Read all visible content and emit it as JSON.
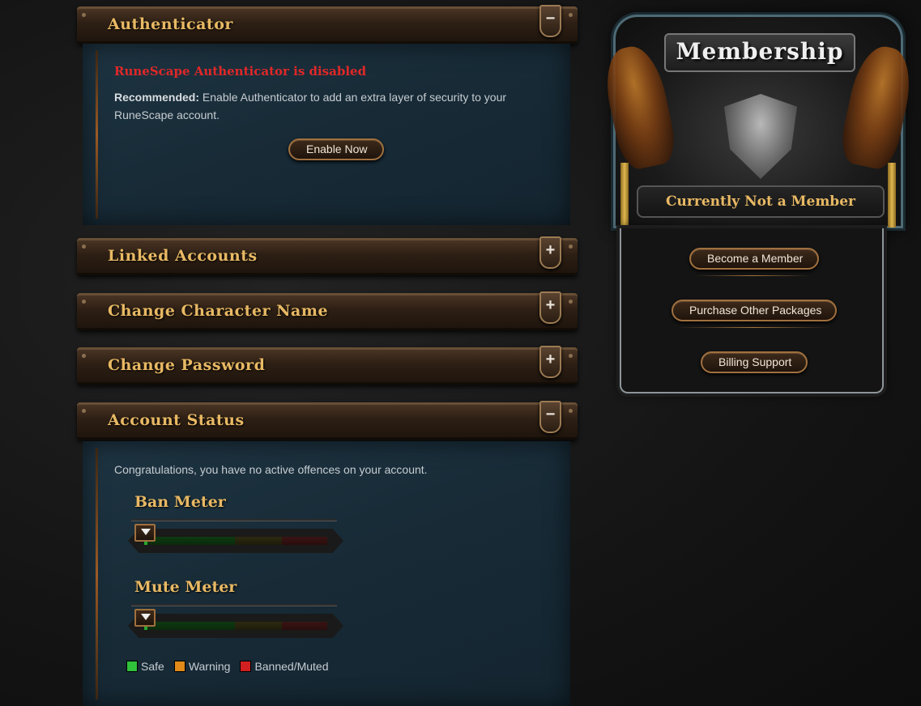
{
  "sections": {
    "authenticator": {
      "title": "Authenticator",
      "toggle": "−"
    },
    "linked": {
      "title": "Linked Accounts",
      "toggle": "+"
    },
    "character": {
      "title": "Change Character Name",
      "toggle": "+"
    },
    "password": {
      "title": "Change Password",
      "toggle": "+"
    },
    "status": {
      "title": "Account Status",
      "toggle": "−"
    }
  },
  "authenticator": {
    "status": "RuneScape Authenticator is disabled",
    "recommended_label": "Recommended:",
    "recommended_text": " Enable Authenticator to add an extra layer of security to your RuneScape account.",
    "button": "Enable Now"
  },
  "account_status": {
    "congrats": "Congratulations, you have no active offences on your account.",
    "ban_meter": {
      "title": "Ban Meter",
      "level": 0
    },
    "mute_meter": {
      "title": "Mute Meter",
      "level": 0
    },
    "legend": [
      {
        "label": "Safe",
        "color": "#2fc23a"
      },
      {
        "label": "Warning",
        "color": "#e08a1a"
      },
      {
        "label": "Banned/Muted",
        "color": "#d21f1f"
      }
    ]
  },
  "membership": {
    "title": "Membership",
    "status": "Currently Not a Member",
    "buttons": {
      "become": "Become a Member",
      "packages": "Purchase Other Packages",
      "billing": "Billing Support"
    }
  },
  "colors": {
    "accent_gold": "#e8b964",
    "alert_red": "#e02828",
    "panel_blue": "#1a2e3b"
  }
}
